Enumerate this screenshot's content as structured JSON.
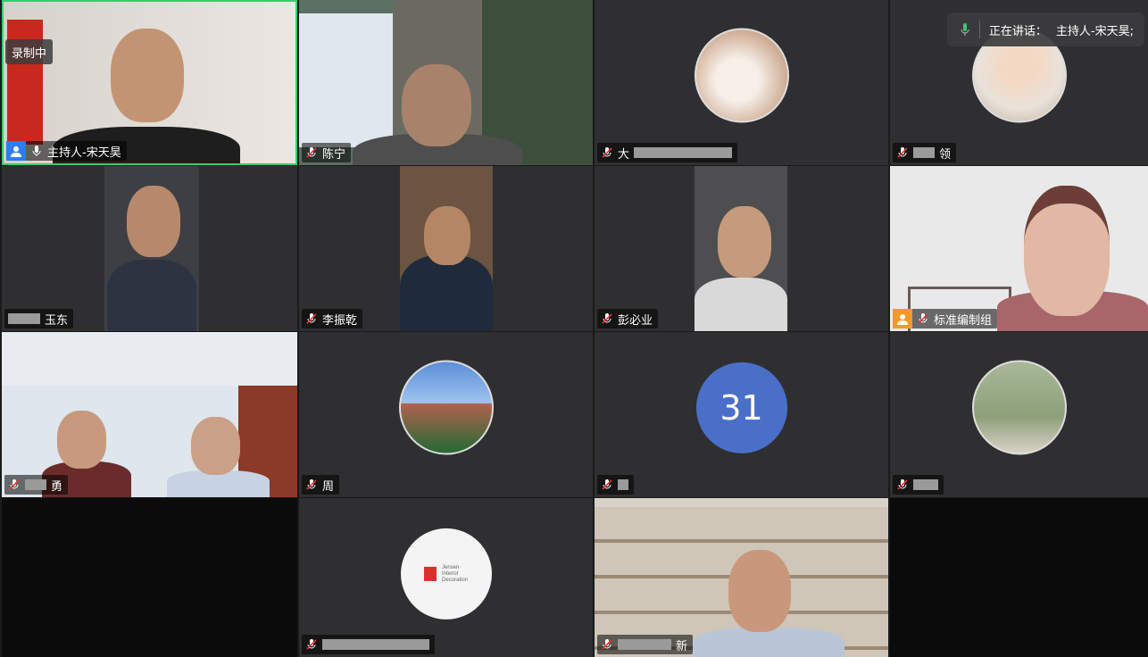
{
  "recording_label": "录制中",
  "speaking": {
    "prefix": "正在讲话：",
    "name": "主持人-宋天昊;"
  },
  "tiles": [
    {
      "name": "主持人-宋天昊"
    },
    {
      "name": "陈宁"
    },
    {
      "name": "大"
    },
    {
      "name": "领"
    },
    {
      "name": "玉东"
    },
    {
      "name": "李振乾"
    },
    {
      "name": "彭必业"
    },
    {
      "name": "标准编制组"
    },
    {
      "name": "勇"
    },
    {
      "name": "周"
    },
    {
      "name": "31"
    },
    {
      "name": ""
    },
    {
      "name": ""
    },
    {
      "name": ""
    },
    {
      "name": "新"
    }
  ],
  "logo": {
    "line1": "Jensen",
    "line2": "Interior",
    "line3": "Decoration"
  },
  "colors": {
    "active_border": "#2fd06e",
    "host_badge": "#2d7cf6",
    "org_badge": "#f39a24",
    "tile_bg": "#2f2f31"
  }
}
